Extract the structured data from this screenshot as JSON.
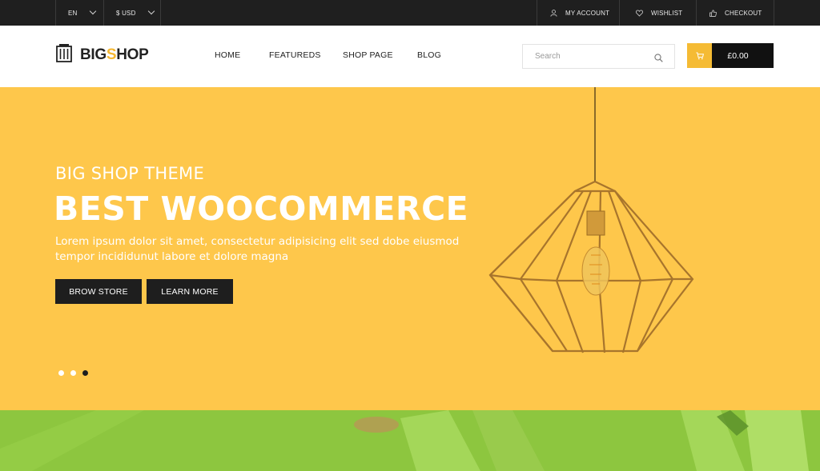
{
  "topbar": {
    "language": "EN",
    "currency": "$ USD",
    "my_account": "MY ACCOUNT",
    "wishlist": "WISHLIST",
    "checkout": "CHECKOUT"
  },
  "header": {
    "logo_part1": "BIG",
    "logo_accent": "S",
    "logo_part2": "HOP",
    "nav": [
      "HOME",
      "FEATUREDS",
      "SHOP PAGE",
      "BLOG"
    ],
    "search_placeholder": "Search",
    "cart_total": "£0.00"
  },
  "hero": {
    "subtitle": "BIG SHOP THEME",
    "title": "BEST WOOCOMMERCE",
    "description": "Lorem ipsum dolor sit amet, consectetur adipisicing elit sed dobe eiusmod tempor incididunut labore et dolore magna",
    "buttons": [
      "BROW STORE",
      "LEARN MORE"
    ],
    "slides": 3,
    "active_slide": 3
  },
  "colors": {
    "accent": "#f5bb34",
    "hero_bg": "#fec74b",
    "dark": "#1e1e1e",
    "green_band": "#8dc63f"
  },
  "icons": [
    "chevron-down-icon",
    "user-icon",
    "heart-icon",
    "thumbs-up-icon",
    "building-logo-icon",
    "search-icon",
    "cart-icon"
  ]
}
